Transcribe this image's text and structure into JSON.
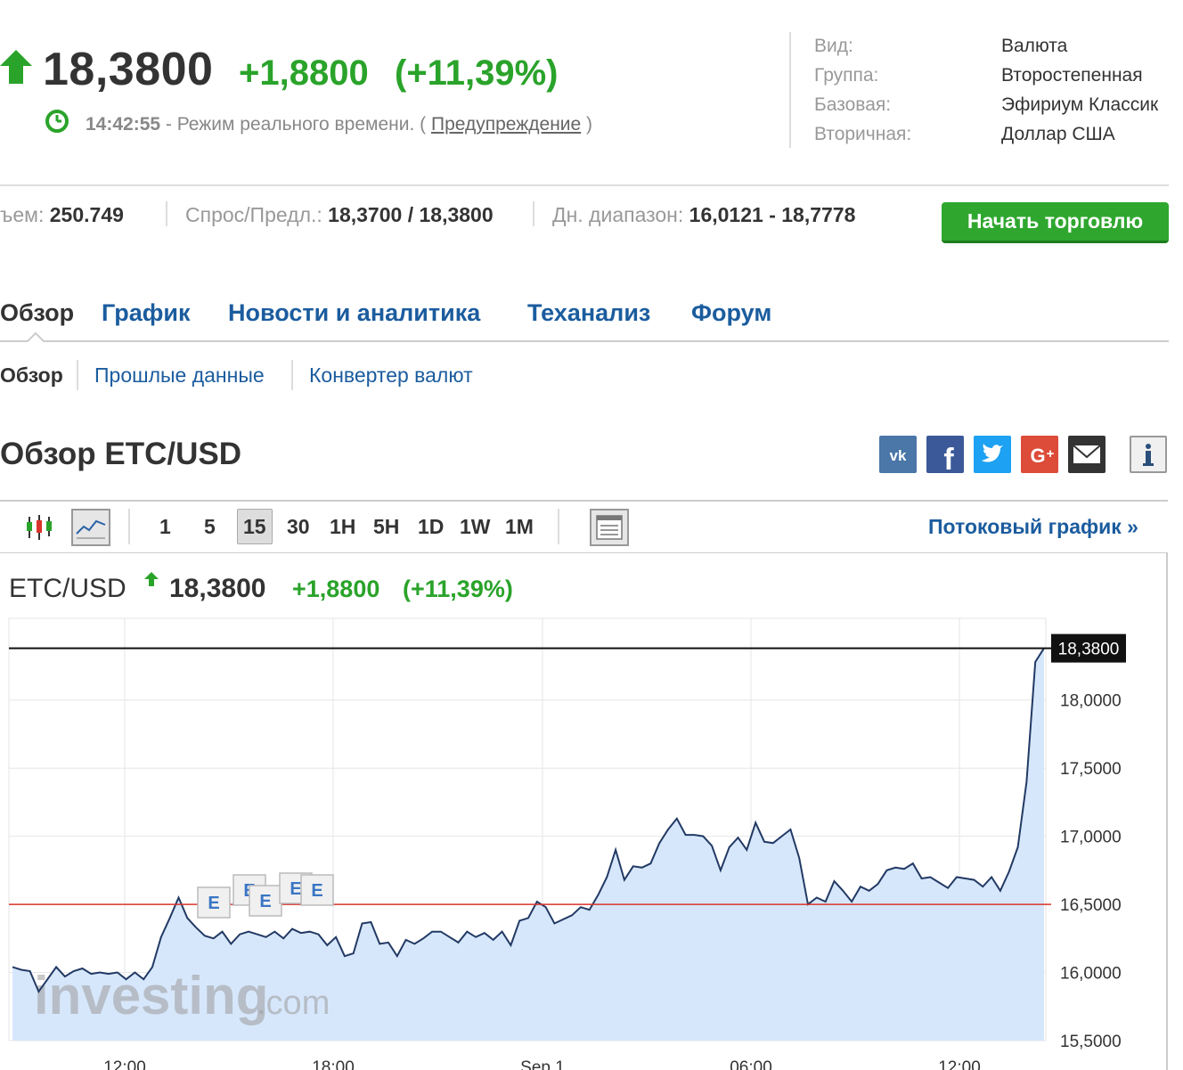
{
  "quote": {
    "price": "18,3800",
    "change": "+1,8800",
    "change_pct": "(+11,39%)",
    "time": "14:42:55",
    "mode_text": " - Режим реального времени. ( ",
    "warning_link": "Предупреждение",
    "close_paren": " )",
    "up_color": "#2aa32a"
  },
  "info": [
    {
      "label": "Вид:",
      "value": "Валюта"
    },
    {
      "label": "Группа:",
      "value": "Второстепенная"
    },
    {
      "label": "Базовая:",
      "value": "Эфириум Классик"
    },
    {
      "label": "Вторичная:",
      "value": "Доллар США"
    }
  ],
  "stats": {
    "volume_label": "ъем: ",
    "volume_value": "250.749",
    "bidask_label": "Спрос/Предл.: ",
    "bidask_value": "18,3700 / 18,3800",
    "range_label": "Дн. диапазон: ",
    "range_value": "16,0121 - 18,7778"
  },
  "trade_button": "Начать торговлю",
  "tabs": [
    "Обзор",
    "График",
    "Новости и аналитика",
    "Теханализ",
    "Форум"
  ],
  "subtabs": [
    "Обзор",
    "Прошлые данные",
    "Конвертер валют"
  ],
  "section_title": "Обзор ETC/USD",
  "share_icons": [
    {
      "name": "vk-icon",
      "text": "ВК",
      "color": "#4a76a8"
    },
    {
      "name": "facebook-icon",
      "text": "f",
      "color": "#3b5998"
    },
    {
      "name": "twitter-icon",
      "text": "t",
      "color": "#1da1f2"
    },
    {
      "name": "google-plus-icon",
      "text": "G+",
      "color": "#dd4b39"
    },
    {
      "name": "email-icon",
      "text": "✉",
      "color": "#333333"
    },
    {
      "name": "info-icon",
      "text": "i",
      "color": "#eeeeee"
    }
  ],
  "toolbar": {
    "periods": [
      "1",
      "5",
      "15",
      "30",
      "1H",
      "5H",
      "1D",
      "1W",
      "1M"
    ],
    "selected_period": "15",
    "stream_link": "Потоковый график »"
  },
  "chart_header": {
    "symbol": "ETC/USD",
    "price": "18,3800",
    "change": "+1,8800",
    "change_pct": "(+11,39%)"
  },
  "chart_data": {
    "type": "area",
    "x_labels": [
      "12:00",
      "18:00",
      "Sep 1",
      "06:00",
      "12:00"
    ],
    "y_ticks": [
      "15,5000",
      "16,0000",
      "16,5000",
      "17,0000",
      "17,5000",
      "18,0000"
    ],
    "ylim": [
      15.5,
      18.6
    ],
    "current_price_label": "18,3800",
    "current_price": 18.38,
    "reference_line": 16.5,
    "event_markers": [
      "E",
      "E",
      "E",
      "E",
      "E"
    ],
    "watermark": "investing.com",
    "series": [
      {
        "values": [
          16.04,
          16.02,
          16.01,
          15.86,
          15.95,
          16.04,
          15.97,
          16.01,
          16.03,
          15.99,
          16.0,
          15.99,
          16.0,
          15.95,
          16.0,
          15.95,
          16.04,
          16.26,
          16.4,
          16.55,
          16.4,
          16.33,
          16.27,
          16.25,
          16.3,
          16.21,
          16.28,
          16.3,
          16.28,
          16.26,
          16.3,
          16.25,
          16.32,
          16.29,
          16.3,
          16.28,
          16.2,
          16.26,
          16.12,
          16.14,
          16.36,
          16.37,
          16.21,
          16.22,
          16.12,
          16.24,
          16.21,
          16.25,
          16.3,
          16.3,
          16.26,
          16.22,
          16.3,
          16.26,
          16.29,
          16.24,
          16.3,
          16.2,
          16.38,
          16.4,
          16.52,
          16.48,
          16.36,
          16.39,
          16.42,
          16.48,
          16.46,
          16.57,
          16.7,
          16.9,
          16.68,
          16.78,
          16.77,
          16.8,
          16.95,
          17.05,
          17.13,
          17.01,
          17.01,
          17.0,
          16.93,
          16.75,
          16.92,
          16.99,
          16.9,
          17.1,
          16.96,
          16.95,
          17.0,
          17.05,
          16.84,
          16.5,
          16.55,
          16.52,
          16.67,
          16.6,
          16.52,
          16.63,
          16.6,
          16.65,
          16.75,
          16.77,
          16.76,
          16.8,
          16.69,
          16.7,
          16.66,
          16.62,
          16.7,
          16.69,
          16.68,
          16.63,
          16.7,
          16.6,
          16.74,
          16.92,
          17.4,
          18.28,
          18.38
        ]
      }
    ]
  }
}
